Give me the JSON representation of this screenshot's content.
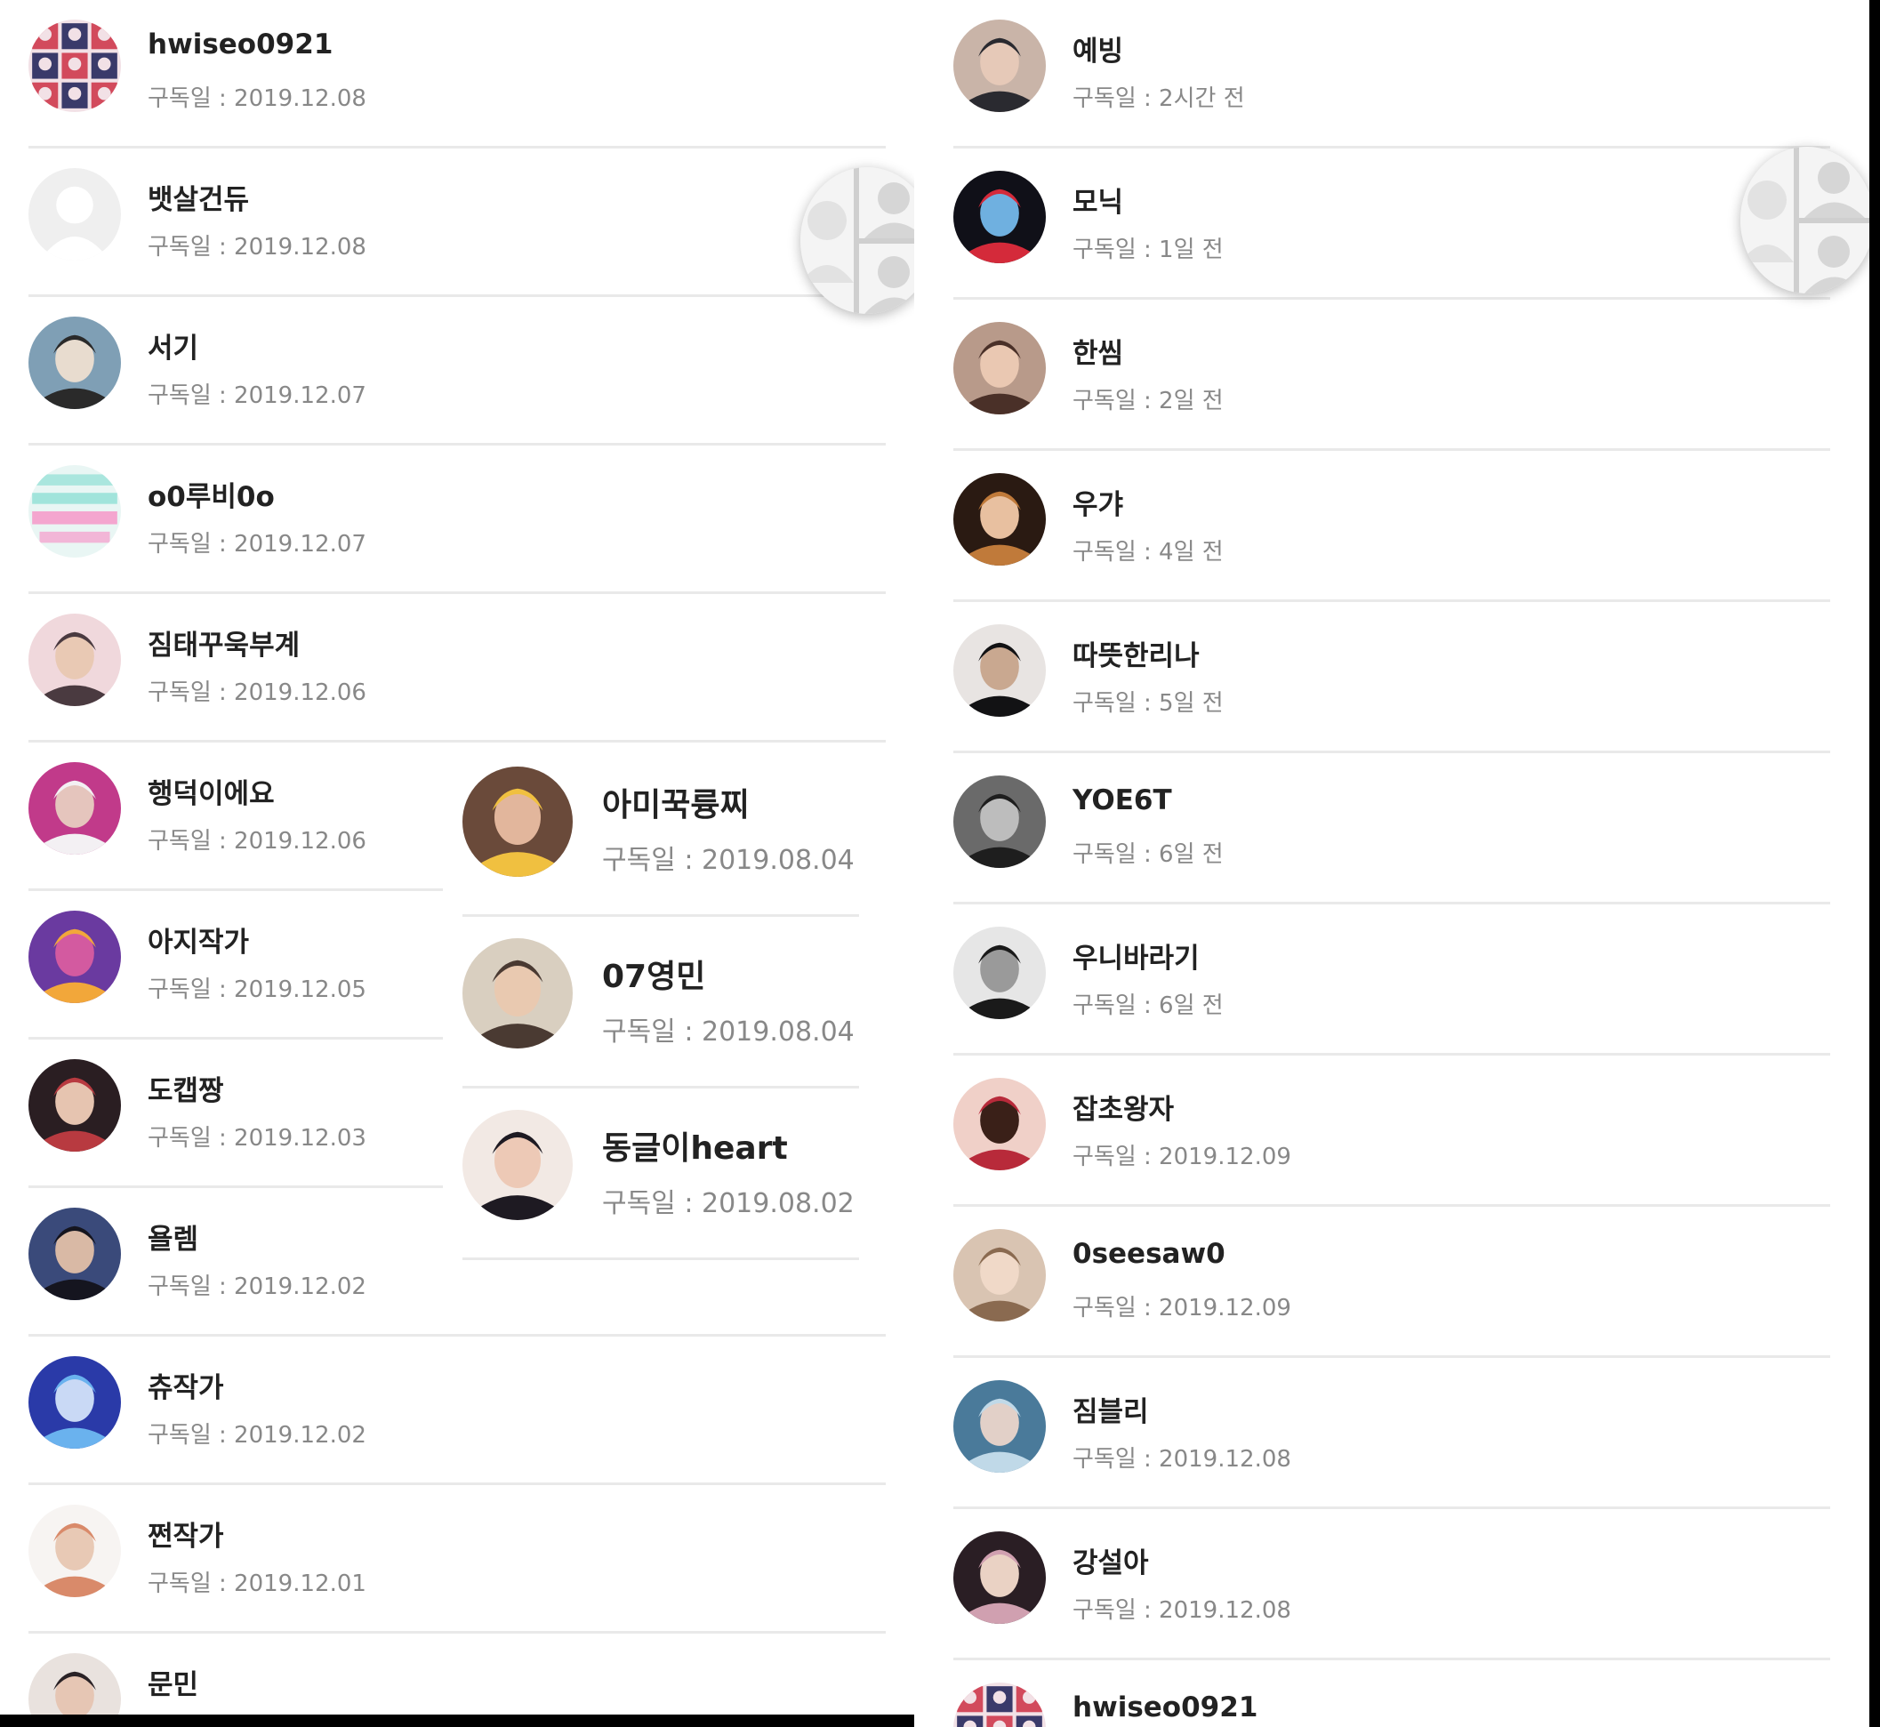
{
  "label_prefix": "구독일 : ",
  "left_list": [
    {
      "name": "hwiseo0921",
      "date": "구독일 : 2019.12.08",
      "icon": "collage-avatar",
      "colors": [
        "#d24a5c",
        "#3a3a6a",
        "#f2e1e6"
      ]
    },
    {
      "name": "뱃살건듀",
      "date": "구독일 : 2019.12.08",
      "icon": "default-avatar",
      "colors": [
        "#ececec",
        "#ffffff",
        "#ffffff"
      ]
    },
    {
      "name": "서기",
      "date": "구독일 : 2019.12.07",
      "icon": "photo-avatar",
      "colors": [
        "#7f9fb5",
        "#2a2a2a",
        "#e8dccf"
      ]
    },
    {
      "name": "o0루비0o",
      "date": "구독일 : 2019.12.07",
      "icon": "text-avatar",
      "colors": [
        "#e9f6f4",
        "#8fe0d4",
        "#f4a6cf"
      ]
    },
    {
      "name": "짐태꾸욱부계",
      "date": "구독일 : 2019.12.06",
      "icon": "photo-avatar",
      "colors": [
        "#f0d8dc",
        "#4a3a40",
        "#e9c9b4"
      ]
    },
    {
      "name": "행덕이에요",
      "date": "구독일 : 2019.12.06",
      "icon": "photo-avatar",
      "colors": [
        "#c13a8a",
        "#f3f0f3",
        "#e5c5bd"
      ]
    },
    {
      "name": "아지작가",
      "date": "구독일 : 2019.12.05",
      "icon": "photo-avatar",
      "colors": [
        "#6a3aa0",
        "#f2a73a",
        "#d35aa0"
      ]
    },
    {
      "name": "도캡짱",
      "date": "구독일 : 2019.12.03",
      "icon": "photo-avatar",
      "colors": [
        "#2a1e22",
        "#b83a40",
        "#e6c4b0"
      ]
    },
    {
      "name": "욜렘",
      "date": "구독일 : 2019.12.02",
      "icon": "photo-avatar",
      "colors": [
        "#3a4a7a",
        "#15151f",
        "#d9b9a5"
      ]
    },
    {
      "name": "츄작가",
      "date": "구독일 : 2019.12.02",
      "icon": "photo-avatar",
      "colors": [
        "#2a3aa8",
        "#6ab2ee",
        "#c9d9f5"
      ]
    },
    {
      "name": "쩐작가",
      "date": "구독일 : 2019.12.01",
      "icon": "photo-avatar",
      "colors": [
        "#f7f4f2",
        "#d98a6a",
        "#e8c9b5"
      ]
    },
    {
      "name": "문민",
      "date": "",
      "icon": "photo-avatar",
      "colors": [
        "#e9e2de",
        "#2a2226",
        "#e6c6b4"
      ]
    }
  ],
  "overlay_list": [
    {
      "name": "아미꾹륭찌",
      "date": "구독일 : 2019.08.04",
      "icon": "photo-avatar",
      "colors": [
        "#6a4a3a",
        "#f0c040",
        "#e2b69c"
      ]
    },
    {
      "name": "07영민",
      "date": "구독일 : 2019.08.04",
      "icon": "photo-avatar",
      "colors": [
        "#d9cfc0",
        "#4a3a32",
        "#e9c9b0"
      ]
    },
    {
      "name": "동글이heart",
      "date": "구독일 : 2019.08.02",
      "icon": "photo-avatar",
      "colors": [
        "#f2e9e4",
        "#1e1a22",
        "#edc9b6"
      ]
    }
  ],
  "right_list": [
    {
      "name": "예빙",
      "date": "구독일 : 2시간 전",
      "icon": "photo-avatar",
      "colors": [
        "#c9b4a8",
        "#2a2a30",
        "#e6c9b8"
      ]
    },
    {
      "name": "모닉",
      "date": "구독일 : 1일 전",
      "icon": "photo-avatar",
      "colors": [
        "#101018",
        "#d42a3a",
        "#6fb0e0"
      ]
    },
    {
      "name": "한씸",
      "date": "구독일 : 2일 전",
      "icon": "photo-avatar",
      "colors": [
        "#b89a8a",
        "#4a3028",
        "#eac8b2"
      ]
    },
    {
      "name": "우갸",
      "date": "구독일 : 4일 전",
      "icon": "photo-avatar",
      "colors": [
        "#2a1a12",
        "#c07a3a",
        "#e8c0a0"
      ]
    },
    {
      "name": "따뜻한리나",
      "date": "구독일 : 5일 전",
      "icon": "photo-avatar",
      "colors": [
        "#e8e4e2",
        "#121214",
        "#c9a890"
      ]
    },
    {
      "name": "YOE6T",
      "date": "구독일 : 6일 전",
      "icon": "photo-avatar",
      "colors": [
        "#6a6a6a",
        "#1e1e1e",
        "#bdbdbd"
      ]
    },
    {
      "name": "우니바라기",
      "date": "구독일 : 6일 전",
      "icon": "photo-avatar",
      "colors": [
        "#e6e6e6",
        "#1a1a1a",
        "#9a9a9a"
      ]
    },
    {
      "name": "잡초왕자",
      "date": "구독일 : 2019.12.09",
      "icon": "photo-avatar",
      "colors": [
        "#f0d0c8",
        "#b82a3a",
        "#3a2018"
      ]
    },
    {
      "name": "0seesaw0",
      "date": "구독일 : 2019.12.09",
      "icon": "photo-avatar",
      "colors": [
        "#d9c4b2",
        "#8a6a50",
        "#f0d9c8"
      ]
    },
    {
      "name": "짐블리",
      "date": "구독일 : 2019.12.08",
      "icon": "photo-avatar",
      "colors": [
        "#4a7a9a",
        "#c0d9e8",
        "#e2d0c8"
      ]
    },
    {
      "name": "강설아",
      "date": "구독일 : 2019.12.08",
      "icon": "photo-avatar",
      "colors": [
        "#2a1e24",
        "#d0a0b0",
        "#ead2c4"
      ]
    },
    {
      "name": "hwiseo0921",
      "date": "",
      "icon": "collage-avatar",
      "colors": [
        "#d24a5c",
        "#3a3a6a",
        "#f2e1e6"
      ]
    }
  ],
  "floating_buttons": [
    {
      "icon": "profile-switch-icon",
      "colors": [
        "#f4f4f4",
        "#cfcfcf"
      ]
    },
    {
      "icon": "profile-switch-icon",
      "colors": [
        "#f4f4f4",
        "#cfcfcf"
      ]
    }
  ]
}
